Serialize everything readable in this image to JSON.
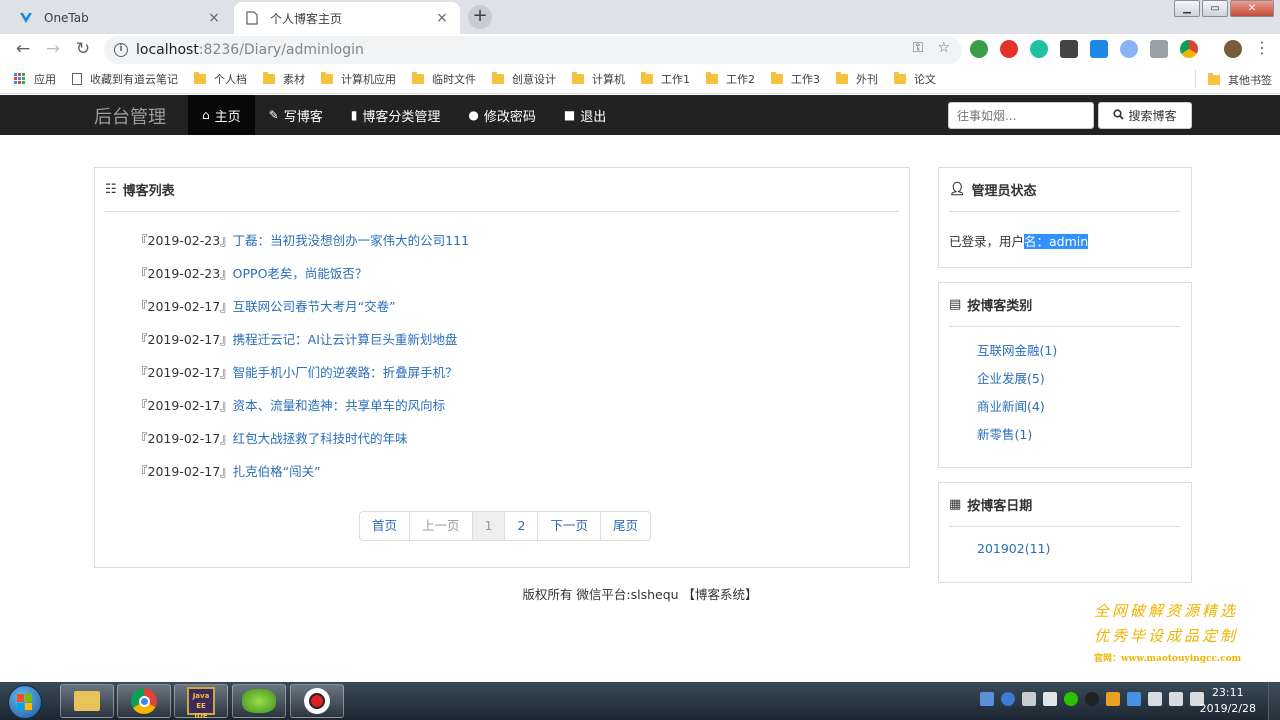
{
  "browser": {
    "tabs": [
      {
        "title": "OneTab",
        "close": "×"
      },
      {
        "title": "个人博客主页",
        "close": "×"
      }
    ],
    "new_tab": "+",
    "url_host": "localhost",
    "url_path": ":8236/Diary/adminlogin",
    "bookmarks": [
      {
        "label": "应用",
        "icon": "apps-icon"
      },
      {
        "label": "收藏到有道云笔记",
        "icon": "page-icon"
      },
      {
        "label": "个人档",
        "icon": "folder-icon"
      },
      {
        "label": "素材",
        "icon": "folder-icon"
      },
      {
        "label": "计算机应用",
        "icon": "folder-icon"
      },
      {
        "label": "临时文件",
        "icon": "folder-icon"
      },
      {
        "label": "创意设计",
        "icon": "folder-icon"
      },
      {
        "label": "计算机",
        "icon": "folder-icon"
      },
      {
        "label": "工作1",
        "icon": "folder-icon"
      },
      {
        "label": "工作2",
        "icon": "folder-icon"
      },
      {
        "label": "工作3",
        "icon": "folder-icon"
      },
      {
        "label": "外刊",
        "icon": "folder-icon"
      },
      {
        "label": "论文",
        "icon": "folder-icon"
      }
    ],
    "other_bookmarks": "其他书签"
  },
  "navbar": {
    "brand": "后台管理",
    "items": [
      {
        "label": "主页",
        "icon": "home-icon",
        "glyph": "⌂"
      },
      {
        "label": "写博客",
        "icon": "pencil-icon",
        "glyph": "✎"
      },
      {
        "label": "博客分类管理",
        "icon": "book-icon",
        "glyph": "▮"
      },
      {
        "label": "修改密码",
        "icon": "user-icon",
        "glyph": "●"
      },
      {
        "label": "退出",
        "icon": "stop-icon",
        "glyph": "■"
      }
    ],
    "search_placeholder": "往事如烟...",
    "search_button": "搜索博客"
  },
  "blog_list": {
    "heading": "博客列表",
    "items": [
      {
        "date": "『2019-02-23』",
        "title": "丁磊：当初我没想创办一家伟大的公司111"
      },
      {
        "date": "『2019-02-23』",
        "title": "OPPO老矣，尚能饭否？"
      },
      {
        "date": "『2019-02-17』",
        "title": "互联网公司春节大考月“交卷”"
      },
      {
        "date": "『2019-02-17』",
        "title": "携程迁云记：AI让云计算巨头重新划地盘"
      },
      {
        "date": "『2019-02-17』",
        "title": "智能手机小厂们的逆袭路：折叠屏手机？"
      },
      {
        "date": "『2019-02-17』",
        "title": "资本、流量和造神：共享单车的风向标"
      },
      {
        "date": "『2019-02-17』",
        "title": "红包大战拯救了科技时代的年味"
      },
      {
        "date": "『2019-02-17』",
        "title": "扎克伯格“闯关”"
      }
    ],
    "pager": {
      "first": "首页",
      "prev": "上一页",
      "page1": "1",
      "page2": "2",
      "next": "下一页",
      "last": "尾页"
    }
  },
  "sidebar": {
    "admin": {
      "heading": "管理员状态",
      "status_prefix": "已登录，用户",
      "status_selected": "名：admin"
    },
    "categories": {
      "heading": "按博客类别",
      "items": [
        "互联网金融(1)",
        "企业发展(5)",
        "商业新闻(4)",
        "新零售(1)"
      ]
    },
    "dates": {
      "heading": "按博客日期",
      "items": [
        "201902(11)"
      ]
    }
  },
  "footer": "版权所有 微信平台:slshequ 【博客系统】",
  "watermark": {
    "line1": "全网破解资源精选",
    "line2": "优秀毕设成品定制",
    "line3": "官网：www.maotouyingcc.com"
  },
  "taskbar": {
    "time": "23:11",
    "date": "2019/2/28"
  },
  "colors": {
    "link": "#2a6ebb",
    "navbar_bg": "#222222",
    "selection": "#3390ff"
  }
}
